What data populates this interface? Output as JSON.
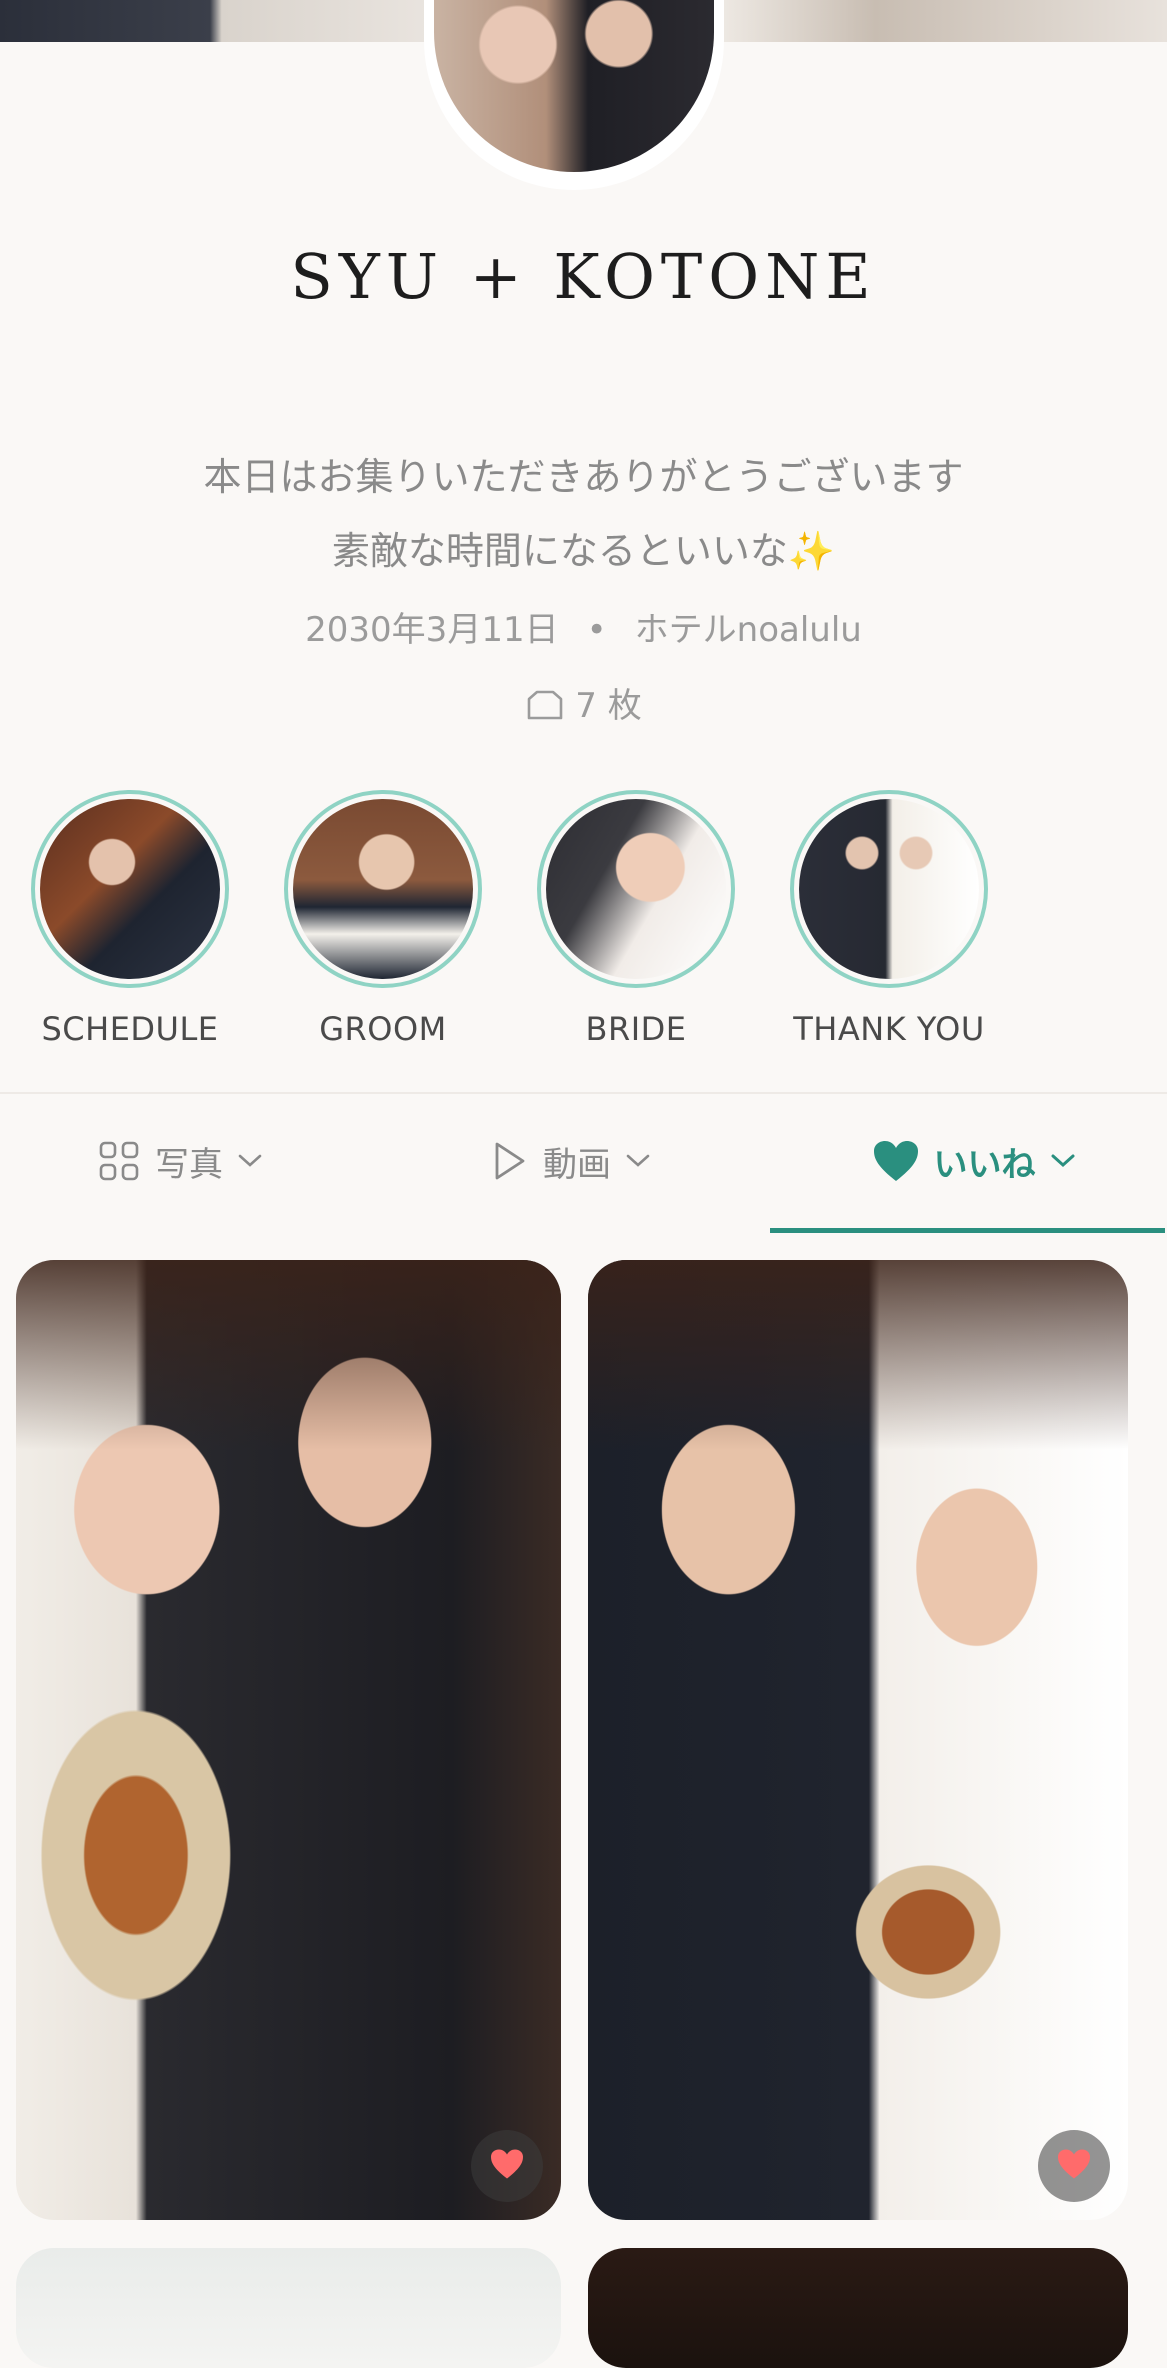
{
  "profile": {
    "title": "SYU + KOTONE",
    "message_line1": "本日はお集りいただきありがとうございます",
    "message_line2": "素敵な時間になるといいな✨",
    "date": "2030年3月11日",
    "separator": "•",
    "venue": "ホテルnoalulu",
    "photo_count": "7 枚"
  },
  "highlights": [
    {
      "label": "SCHEDULE"
    },
    {
      "label": "GROOM"
    },
    {
      "label": "BRIDE"
    },
    {
      "label": "THANK YOU"
    }
  ],
  "tabs": [
    {
      "label": "写真",
      "icon": "grid-icon"
    },
    {
      "label": "動画",
      "icon": "play-icon"
    },
    {
      "label": "いいね",
      "icon": "heart-icon",
      "active": true
    }
  ],
  "colors": {
    "accent": "#2a8f7f",
    "ring": "#8fd3c4",
    "like": "#ff6b6b",
    "background": "#faf8f6"
  }
}
